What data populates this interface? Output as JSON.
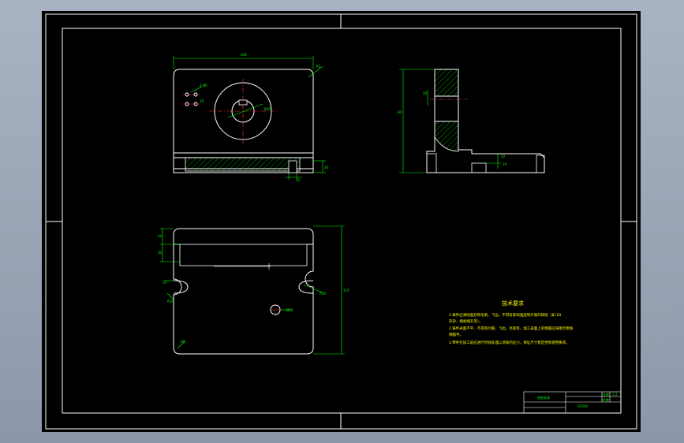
{
  "colors": {
    "background_outer": "#a0aab9",
    "viewport": "#000000",
    "outline": "#ffffff",
    "dimension": "#00ff00",
    "hatch": "#00ff00",
    "notes": "#ffff00",
    "centerline": "#ff3333"
  },
  "dimensions": {
    "top_width": "200",
    "hole_dia": "Ø35",
    "hole_dia_small": "2-Ø6",
    "bore_depth": "60",
    "bracket_height": "80",
    "slot_width": "10",
    "thickness": "20",
    "plan_height": "110",
    "plan_depth": "20",
    "plan_side": "30",
    "slot_radius": "R10",
    "notch": "10",
    "hole_label": "Ø10",
    "corner_radius": "R5"
  },
  "notes": {
    "title": "技术要求",
    "lines": [
      "1.铸件应清除型砂和毛刺、飞边，不得有影响强度和外观的缺陷（如 1B",
      "  夹杂、缩松缩孔等）。",
      "2.铸件表面不平、不得有凹痕、飞边、毛刺等，加工表面上的倒圆应按图示倒角",
      "  倒圆平。",
      "3.零件在加工前应进行时效处理以消除内应力，保证尺寸稳定性和使用要求。"
    ]
  },
  "title_block": {
    "part_name": "铣削夹具",
    "scale_label": "比例",
    "scale_value": "1:2",
    "qty_label": "件数",
    "material": "HT200"
  }
}
